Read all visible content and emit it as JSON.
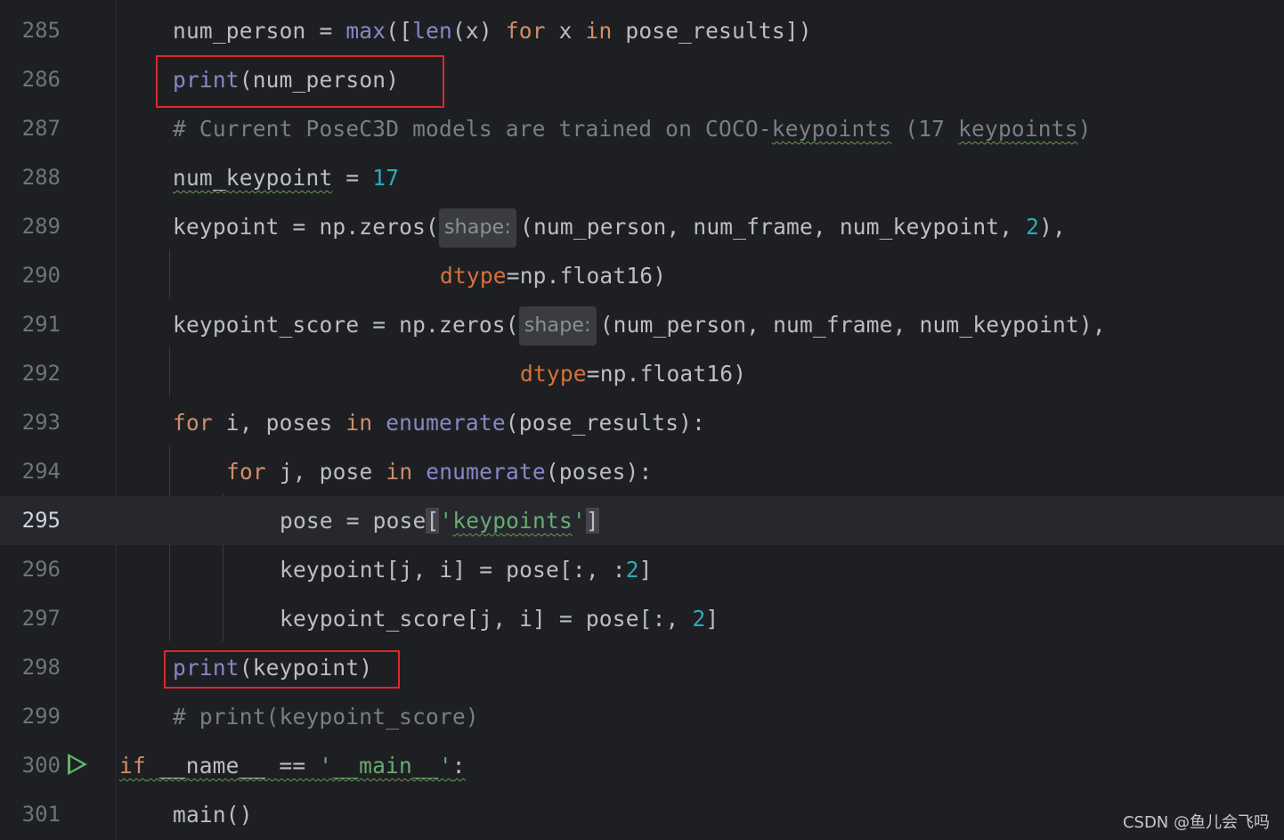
{
  "lines": [
    {
      "n": "285"
    },
    {
      "n": "286"
    },
    {
      "n": "287"
    },
    {
      "n": "288"
    },
    {
      "n": "289"
    },
    {
      "n": "290"
    },
    {
      "n": "291"
    },
    {
      "n": "292"
    },
    {
      "n": "293"
    },
    {
      "n": "294"
    },
    {
      "n": "295"
    },
    {
      "n": "296"
    },
    {
      "n": "297"
    },
    {
      "n": "298"
    },
    {
      "n": "299"
    },
    {
      "n": "300"
    },
    {
      "n": "301"
    }
  ],
  "hints": {
    "shape": "shape:"
  },
  "watermark": "CSDN @鱼儿会飞吗",
  "colors": {
    "background": "#1e1f22",
    "keyword": "#cf8e6d",
    "builtin": "#8888c6",
    "number": "#2aacb8",
    "string": "#6aab73",
    "comment": "#7a7e85",
    "param": "#d5723d",
    "highlight_box": "#e0262b",
    "run_icon": "#5fb865"
  }
}
